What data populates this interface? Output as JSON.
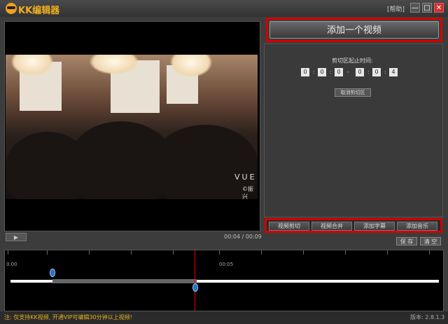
{
  "app": {
    "title": "KK编辑器",
    "help": "[帮助]"
  },
  "window": {
    "min": "—",
    "max": "□",
    "close": "✕"
  },
  "player": {
    "play_icon": "play-icon",
    "timecode": "00:04 / 00:09",
    "watermark_title": "VUE",
    "watermark_sub": "©振兴"
  },
  "actions": {
    "add_video": "添加一个视频"
  },
  "cut_panel": {
    "range_label": "剪切区起止时间:",
    "start": [
      "0",
      "0",
      "0"
    ],
    "end": [
      "0",
      "0",
      "4"
    ],
    "separator": ":",
    "dash": "-",
    "cancel_label": "取消剪切区"
  },
  "tabs": [
    {
      "label": "视频剪切"
    },
    {
      "label": "视频合并"
    },
    {
      "label": "添加字幕"
    },
    {
      "label": "添加音乐"
    }
  ],
  "buttons": {
    "save": "保 存",
    "clear": "清 空"
  },
  "timeline": {
    "label_start": "0:00",
    "label_mid": "00:05"
  },
  "status": {
    "note": "注: 仅支持KK视频, 开通VIP可编辑30分钟以上视频!",
    "version": "版本: 2.8.1.3"
  },
  "colors": {
    "accent": "#d40000",
    "brand": "#f0b020",
    "playhead": "#e00000"
  }
}
